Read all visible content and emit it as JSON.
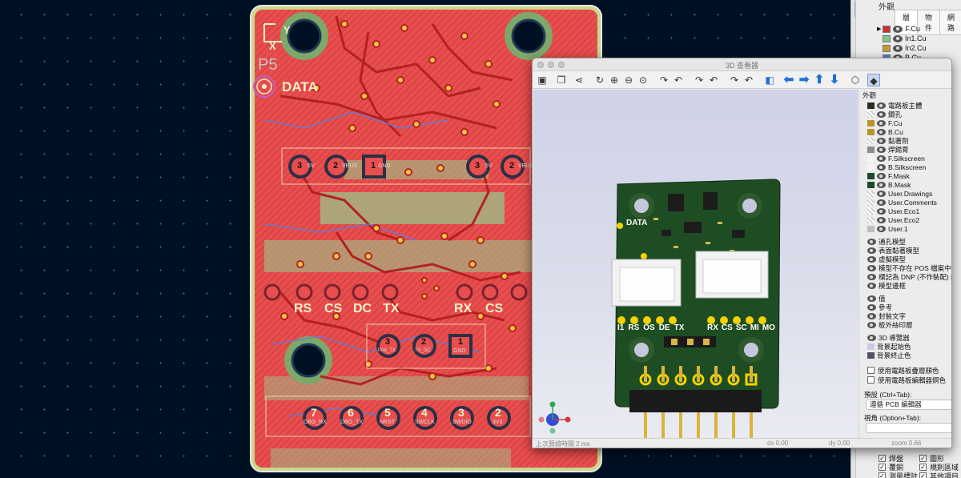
{
  "pcb": {
    "ref_designator": "P5",
    "data_label": "DATA",
    "axis_x": "X",
    "axis_y": "Y",
    "pad_row_labels": [
      "RS",
      "CS",
      "DC",
      "TX",
      "RX",
      "CS"
    ],
    "top_pads": [
      {
        "num": "3",
        "label": "5V"
      },
      {
        "num": "2",
        "label": "VBUS"
      },
      {
        "num": "1",
        "label": "GND"
      },
      {
        "num": "3",
        "label": "5V"
      },
      {
        "num": "2",
        "label": "VBUS"
      }
    ],
    "mid_pads": [
      {
        "num": "3",
        "label": "PA8_TX"
      },
      {
        "num": "2",
        "label": "TX_DC"
      },
      {
        "num": "1",
        "label": "GND"
      }
    ],
    "bottom_pads": [
      {
        "num": "7",
        "label": "DBG_RX"
      },
      {
        "num": "6",
        "label": "DBG_TX"
      },
      {
        "num": "5",
        "label": "NRST"
      },
      {
        "num": "4",
        "label": "SWCLK"
      },
      {
        "num": "3",
        "label": "SWDIO"
      },
      {
        "num": "2",
        "label": "3V3"
      }
    ]
  },
  "layers_panel": {
    "title": "外觀",
    "tabs": [
      "層",
      "物件",
      "網路"
    ],
    "layers": [
      {
        "name": "F.Cu",
        "color": "#c83434"
      },
      {
        "name": "In1.Cu",
        "color": "#7fc87f"
      },
      {
        "name": "In2.Cu",
        "color": "#c89a32"
      },
      {
        "name": "B.Cu",
        "color": "#4d7fc4"
      }
    ],
    "bottom_checks": [
      {
        "label": "焊盤",
        "checked": true
      },
      {
        "label": "圖形",
        "checked": true
      },
      {
        "label": "覆銅",
        "checked": true
      },
      {
        "label": "規則區域",
        "checked": true
      },
      {
        "label": "測量標註",
        "checked": true
      },
      {
        "label": "其他項目",
        "checked": true
      }
    ]
  },
  "viewer": {
    "title": "3D 查看器",
    "board_labels": {
      "data": "DATA",
      "pins_left": [
        "I1",
        "RS",
        "OS",
        "DE",
        "TX"
      ],
      "pins_right": [
        "RX",
        "CS",
        "SC",
        "MI",
        "MO"
      ]
    },
    "appearance": {
      "title": "外觀",
      "items": [
        {
          "label": "電路板主體",
          "color": "#2d2a1e"
        },
        {
          "label": "鑽孔",
          "color": ""
        },
        {
          "label": "F.Cu",
          "color": "#b8952a"
        },
        {
          "label": "B.Cu",
          "color": "#b8952a"
        },
        {
          "label": "黏著劑",
          "color": ""
        },
        {
          "label": "焊錫膏",
          "color": "#8c8c8c"
        },
        {
          "label": "F.Silkscreen",
          "color": "#f3f3f3"
        },
        {
          "label": "B.Silkscreen",
          "color": "#f3f3f3"
        },
        {
          "label": "F.Mask",
          "color": "#1e4a2c"
        },
        {
          "label": "B.Mask",
          "color": "#1e4a2c"
        },
        {
          "label": "User.Drawings",
          "color": ""
        },
        {
          "label": "User.Comments",
          "color": ""
        },
        {
          "label": "User.Eco1",
          "color": ""
        },
        {
          "label": "User.Eco2",
          "color": ""
        },
        {
          "label": "User.1",
          "color": "#bdbdbd"
        }
      ],
      "model_items": [
        "通孔模型",
        "表面黏著模型",
        "虛擬模型",
        "模型不存在 POS 檔案中",
        "標記為 DNP (不作裝配) 的",
        "模型邊框"
      ],
      "misc_items": [
        "值",
        "參考",
        "封裝文字",
        "板外絲印層"
      ],
      "nav_item": "3D 導覽器",
      "bg_items": [
        {
          "label": "背景起始色",
          "color": "#c9cbe4"
        },
        {
          "label": "背景終止色",
          "color": "#55506a"
        }
      ],
      "checkbox_items": [
        "使用電路板疊層顏色",
        "使用電路板編輯器銅色"
      ],
      "preset_label": "預設 (Ctrl+Tab):",
      "preset_value": "遵循 PCB 編輯器",
      "view_label": "視角 (Option+Tab):",
      "view_value": ""
    },
    "status": {
      "render_time": "上次算繪時間 2 ms",
      "dx": "dx 0.00",
      "dy": "dy 0.00",
      "zoom": "zoom 0.66"
    }
  }
}
